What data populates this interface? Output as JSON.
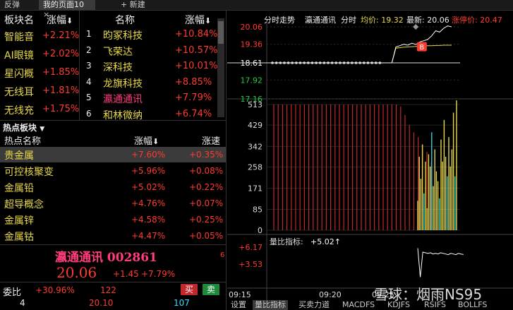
{
  "tabs": [
    {
      "label": "反弹"
    },
    {
      "label": "我的页面10"
    },
    {
      "label": "新建"
    }
  ],
  "sector_table": {
    "headers": {
      "name": "板块名",
      "change": "涨幅"
    },
    "rows": [
      {
        "name": "智能音",
        "change": "+2.21%"
      },
      {
        "name": "AI眼镜",
        "change": "+2.02%"
      },
      {
        "name": "星闪概",
        "change": "+1.85%"
      },
      {
        "name": "无线耳",
        "change": "+1.81%"
      },
      {
        "name": "无线充",
        "change": "+1.75%"
      }
    ]
  },
  "stock_table": {
    "headers": {
      "name": "名称",
      "change": "涨幅"
    },
    "rows": [
      {
        "rank": "1",
        "name": "昀冢科技",
        "change": "+10.84%"
      },
      {
        "rank": "2",
        "name": "飞荣达",
        "change": "+10.57%"
      },
      {
        "rank": "3",
        "name": "深科技",
        "change": "+10.01%"
      },
      {
        "rank": "4",
        "name": "龙旗科技",
        "change": "+8.85%"
      },
      {
        "rank": "5",
        "name": "瀛通通讯",
        "change": "+7.79%"
      },
      {
        "rank": "6",
        "name": "和林微纳",
        "change": "+6.74%"
      }
    ]
  },
  "hot_sectors": {
    "title": "热点板块",
    "headers": {
      "name": "热点名称",
      "change": "涨幅",
      "speed": "涨速"
    },
    "rows": [
      {
        "name": "贵金属",
        "change": "+7.60%",
        "speed": "+0.35%"
      },
      {
        "name": "可控核聚变",
        "change": "+5.96%",
        "speed": "+0.08%"
      },
      {
        "name": "金属铅",
        "change": "+5.02%",
        "speed": "+0.22%"
      },
      {
        "name": "超导概念",
        "change": "+4.76%",
        "speed": "+0.07%"
      },
      {
        "name": "金属锌",
        "change": "+4.58%",
        "speed": "+0.25%"
      },
      {
        "name": "金属钴",
        "change": "+4.47%",
        "speed": "+0.05%"
      }
    ]
  },
  "quote": {
    "name_code": "瀛通通讯 002861",
    "price": "20.06",
    "change": "+1.45",
    "pct": "+7.79%",
    "side_num": "6",
    "weibi_label": "委比",
    "weibi_value": "+30.96%",
    "weibi_vol": "122",
    "buy_label": "买",
    "sell_label": "卖",
    "row_num": "4",
    "bid_price": "20.10",
    "bid_vol": "107"
  },
  "chart_header": {
    "title": "分时走势",
    "stock": "瀛通通讯",
    "mode": "分时",
    "avg": "均价: 19.32",
    "latest": "最新: 20.06",
    "limit": "涨停价: 20.47"
  },
  "price_axis": [
    "20.06",
    "19.36",
    "18.61",
    "17.92",
    "17.16"
  ],
  "volume_axis": [
    "513",
    "429",
    "342",
    "258",
    "171",
    "85",
    "0"
  ],
  "indicator": {
    "title": "量比指标:",
    "value": "+5.02↑",
    "axis": [
      "+6.17",
      "+3.53"
    ]
  },
  "time_axis": [
    "09:15",
    "09:20",
    "09:25"
  ],
  "bottom_tabs": [
    "设置",
    "量比指标",
    "买卖力道",
    "MACDFS",
    "KDJFS",
    "RSIFS",
    "BOLLFS"
  ],
  "marker_label": "B",
  "watermark": "雪球：烟雨NS95",
  "colors": {
    "up": "#ff3b30",
    "down": "#27c93f",
    "avg": "#e8d94a",
    "price": "#ffffff",
    "bar_red": "#c0282a",
    "bar_yellow": "#e8d94a",
    "bar_cyan": "#2fd3d8"
  },
  "chart_data": {
    "type": "line",
    "price_line": [
      18.61,
      18.61,
      18.61,
      18.61,
      18.61,
      18.61,
      18.61,
      18.61,
      18.61,
      18.61,
      18.61,
      18.61,
      18.61,
      18.61,
      18.61,
      18.61,
      18.61,
      18.61,
      18.61,
      18.61,
      18.61,
      18.61,
      18.61,
      18.61,
      18.61,
      18.61,
      18.61,
      18.61,
      18.61,
      18.61,
      18.61,
      19.25,
      19.3,
      19.36,
      19.32,
      19.4,
      19.35,
      19.45,
      19.5,
      19.55,
      19.7,
      19.9,
      19.85,
      20.0,
      20.1,
      20.06
    ],
    "avg_line": [
      18.61,
      18.61,
      18.61,
      18.61,
      18.61,
      18.61,
      18.61,
      18.61,
      18.61,
      18.61,
      18.61,
      18.61,
      18.61,
      18.61,
      18.61,
      18.61,
      18.61,
      18.61,
      18.61,
      18.61,
      18.61,
      18.61,
      18.61,
      18.61,
      18.61,
      18.61,
      18.61,
      18.61,
      18.61,
      18.61,
      18.61,
      19.2,
      19.22,
      19.24,
      19.25,
      19.26,
      19.27,
      19.28,
      19.29,
      19.3,
      19.3,
      19.31,
      19.31,
      19.32,
      19.32,
      19.32
    ],
    "volume_red": [
      513,
      513,
      513,
      513,
      513,
      513,
      513,
      513,
      513,
      513,
      513,
      513,
      513,
      513,
      513,
      513,
      513,
      513,
      513,
      513,
      513,
      513,
      513,
      513,
      513,
      513,
      513,
      513,
      513,
      505,
      470,
      430,
      400,
      380,
      350,
      320,
      280
    ],
    "volume_right": [
      120,
      300,
      210,
      350,
      150,
      280,
      90,
      310,
      260,
      400,
      180,
      330,
      240,
      200,
      130,
      370,
      280,
      450,
      300,
      220,
      380,
      260,
      330,
      480,
      220,
      530
    ],
    "ratio_line": [
      6.0,
      1.5,
      5.4,
      5.3,
      5.2,
      5.3,
      5.1,
      5.2,
      5.1,
      5.3,
      5.2,
      5.1,
      5.0,
      5.2,
      5.1,
      5.0,
      5.2,
      5.1,
      5.02
    ],
    "ylim_price": [
      17.16,
      20.06
    ],
    "ylim_volume": [
      0,
      513
    ],
    "ylim_ratio": [
      0,
      6.17
    ]
  }
}
